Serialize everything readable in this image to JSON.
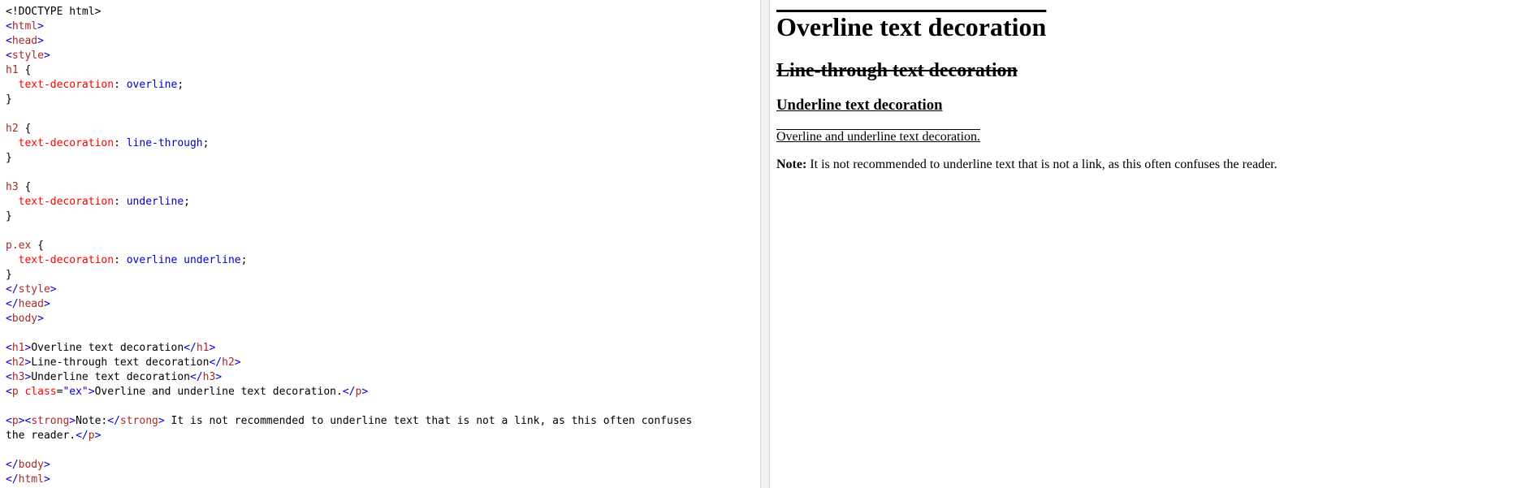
{
  "editor": {
    "lines": [
      [
        {
          "c": "plain",
          "t": "<!DOCTYPE html>"
        }
      ],
      [
        {
          "c": "tag-br",
          "t": "<"
        },
        {
          "c": "tag",
          "t": "html"
        },
        {
          "c": "tag-br",
          "t": ">"
        }
      ],
      [
        {
          "c": "tag-br",
          "t": "<"
        },
        {
          "c": "tag",
          "t": "head"
        },
        {
          "c": "tag-br",
          "t": ">"
        }
      ],
      [
        {
          "c": "tag-br",
          "t": "<"
        },
        {
          "c": "tag",
          "t": "style"
        },
        {
          "c": "tag-br",
          "t": ">"
        }
      ],
      [
        {
          "c": "sel",
          "t": "h1 "
        },
        {
          "c": "plain",
          "t": "{"
        }
      ],
      [
        {
          "c": "plain",
          "t": "  "
        },
        {
          "c": "prop",
          "t": "text-decoration"
        },
        {
          "c": "plain",
          "t": ": "
        },
        {
          "c": "val",
          "t": "overline"
        },
        {
          "c": "plain",
          "t": ";"
        }
      ],
      [
        {
          "c": "plain",
          "t": "}"
        }
      ],
      [
        {
          "c": "plain",
          "t": ""
        }
      ],
      [
        {
          "c": "sel",
          "t": "h2 "
        },
        {
          "c": "plain",
          "t": "{"
        }
      ],
      [
        {
          "c": "plain",
          "t": "  "
        },
        {
          "c": "prop",
          "t": "text-decoration"
        },
        {
          "c": "plain",
          "t": ": "
        },
        {
          "c": "val",
          "t": "line-through"
        },
        {
          "c": "plain",
          "t": ";"
        }
      ],
      [
        {
          "c": "plain",
          "t": "}"
        }
      ],
      [
        {
          "c": "plain",
          "t": ""
        }
      ],
      [
        {
          "c": "sel",
          "t": "h3 "
        },
        {
          "c": "plain",
          "t": "{"
        }
      ],
      [
        {
          "c": "plain",
          "t": "  "
        },
        {
          "c": "prop",
          "t": "text-decoration"
        },
        {
          "c": "plain",
          "t": ": "
        },
        {
          "c": "val",
          "t": "underline"
        },
        {
          "c": "plain",
          "t": ";"
        }
      ],
      [
        {
          "c": "plain",
          "t": "}"
        }
      ],
      [
        {
          "c": "plain",
          "t": ""
        }
      ],
      [
        {
          "c": "sel",
          "t": "p.ex "
        },
        {
          "c": "plain",
          "t": "{"
        }
      ],
      [
        {
          "c": "plain",
          "t": "  "
        },
        {
          "c": "prop",
          "t": "text-decoration"
        },
        {
          "c": "plain",
          "t": ": "
        },
        {
          "c": "val",
          "t": "overline underline"
        },
        {
          "c": "plain",
          "t": ";"
        }
      ],
      [
        {
          "c": "plain",
          "t": "}"
        }
      ],
      [
        {
          "c": "tag-br",
          "t": "</"
        },
        {
          "c": "tag",
          "t": "style"
        },
        {
          "c": "tag-br",
          "t": ">"
        }
      ],
      [
        {
          "c": "tag-br",
          "t": "</"
        },
        {
          "c": "tag",
          "t": "head"
        },
        {
          "c": "tag-br",
          "t": ">"
        }
      ],
      [
        {
          "c": "tag-br",
          "t": "<"
        },
        {
          "c": "tag",
          "t": "body"
        },
        {
          "c": "tag-br",
          "t": ">"
        }
      ],
      [
        {
          "c": "plain",
          "t": ""
        }
      ],
      [
        {
          "c": "tag-br",
          "t": "<"
        },
        {
          "c": "tag",
          "t": "h1"
        },
        {
          "c": "tag-br",
          "t": ">"
        },
        {
          "c": "plain",
          "t": "Overline text decoration"
        },
        {
          "c": "tag-br",
          "t": "</"
        },
        {
          "c": "tag",
          "t": "h1"
        },
        {
          "c": "tag-br",
          "t": ">"
        }
      ],
      [
        {
          "c": "tag-br",
          "t": "<"
        },
        {
          "c": "tag",
          "t": "h2"
        },
        {
          "c": "tag-br",
          "t": ">"
        },
        {
          "c": "plain",
          "t": "Line-through text decoration"
        },
        {
          "c": "tag-br",
          "t": "</"
        },
        {
          "c": "tag",
          "t": "h2"
        },
        {
          "c": "tag-br",
          "t": ">"
        }
      ],
      [
        {
          "c": "tag-br",
          "t": "<"
        },
        {
          "c": "tag",
          "t": "h3"
        },
        {
          "c": "tag-br",
          "t": ">"
        },
        {
          "c": "plain",
          "t": "Underline text decoration"
        },
        {
          "c": "tag-br",
          "t": "</"
        },
        {
          "c": "tag",
          "t": "h3"
        },
        {
          "c": "tag-br",
          "t": ">"
        }
      ],
      [
        {
          "c": "tag-br",
          "t": "<"
        },
        {
          "c": "tag",
          "t": "p "
        },
        {
          "c": "attr",
          "t": "class"
        },
        {
          "c": "plain",
          "t": "="
        },
        {
          "c": "attrv",
          "t": "\"ex\""
        },
        {
          "c": "tag-br",
          "t": ">"
        },
        {
          "c": "plain",
          "t": "Overline and underline text decoration."
        },
        {
          "c": "tag-br",
          "t": "</"
        },
        {
          "c": "tag",
          "t": "p"
        },
        {
          "c": "tag-br",
          "t": ">"
        }
      ],
      [
        {
          "c": "plain",
          "t": ""
        }
      ],
      [
        {
          "c": "tag-br",
          "t": "<"
        },
        {
          "c": "tag",
          "t": "p"
        },
        {
          "c": "tag-br",
          "t": ">"
        },
        {
          "c": "tag-br",
          "t": "<"
        },
        {
          "c": "tag",
          "t": "strong"
        },
        {
          "c": "tag-br",
          "t": ">"
        },
        {
          "c": "plain",
          "t": "Note:"
        },
        {
          "c": "tag-br",
          "t": "</"
        },
        {
          "c": "tag",
          "t": "strong"
        },
        {
          "c": "tag-br",
          "t": ">"
        },
        {
          "c": "plain",
          "t": " It is not recommended to underline text that is not a link, as this often confuses"
        }
      ],
      [
        {
          "c": "plain",
          "t": "the reader."
        },
        {
          "c": "tag-br",
          "t": "</"
        },
        {
          "c": "tag",
          "t": "p"
        },
        {
          "c": "tag-br",
          "t": ">"
        }
      ],
      [
        {
          "c": "plain",
          "t": ""
        }
      ],
      [
        {
          "c": "tag-br",
          "t": "</"
        },
        {
          "c": "tag",
          "t": "body"
        },
        {
          "c": "tag-br",
          "t": ">"
        }
      ],
      [
        {
          "c": "tag-br",
          "t": "</"
        },
        {
          "c": "tag",
          "t": "html"
        },
        {
          "c": "tag-br",
          "t": ">"
        }
      ]
    ]
  },
  "preview": {
    "h1": "Overline text decoration",
    "h2": "Line-through text decoration",
    "h3": "Underline text decoration",
    "p_ex": "Overline and underline text decoration.",
    "note_label": "Note:",
    "note_text": " It is not recommended to underline text that is not a link, as this often confuses the reader."
  },
  "colors": {
    "tag": "#a52a2a",
    "bracket": "#0000cd",
    "property": "#ff0000",
    "value": "#0000cd",
    "divider": "#f1f1f1"
  }
}
